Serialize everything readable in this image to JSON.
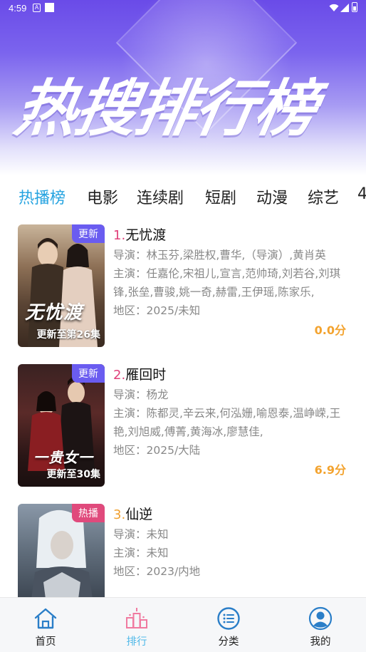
{
  "status_bar": {
    "time": "4:59",
    "a_glyph": "A"
  },
  "header": {
    "title": "热搜排行榜"
  },
  "tabs": [
    {
      "label": "热播榜",
      "active": true
    },
    {
      "label": "电影",
      "active": false
    },
    {
      "label": "连续剧",
      "active": false
    },
    {
      "label": "短剧",
      "active": false
    },
    {
      "label": "动漫",
      "active": false
    },
    {
      "label": "综艺",
      "active": false
    },
    {
      "label": "4",
      "active": false
    }
  ],
  "list": [
    {
      "rank": "1.",
      "rank_color": "#e0407a",
      "title": "无忧渡",
      "badge": "更新",
      "badge_color": "#6a5cf0",
      "poster_caption": "更新至第26集",
      "poster_calligraphy": "无忧渡",
      "director": "导演：林玉芬,梁胜权,曹华,（导演）,黄肖英",
      "cast": "主演：任嘉伦,宋祖儿,宣言,范帅琦,刘若谷,刘琪锋,张垒,曹骏,姚一奇,赫雷,王伊瑶,陈家乐,",
      "region": "地区：2025/未知",
      "score": "0.0分"
    },
    {
      "rank": "2.",
      "rank_color": "#e0407a",
      "title": "雁回时",
      "badge": "更新",
      "badge_color": "#6a5cf0",
      "poster_caption": "更新至30集",
      "poster_calligraphy": "一贵女一",
      "director": "导演：杨龙",
      "cast": "主演：陈都灵,辛云来,何泓姗,喻恩泰,温峥嵘,王艳,刘旭威,傅菁,黄海冰,廖慧佳,",
      "region": "地区：2025/大陆",
      "score": "6.9分"
    },
    {
      "rank": "3.",
      "rank_color": "#f0a030",
      "title": "仙逆",
      "badge": "热播",
      "badge_color": "#e04a7c",
      "poster_caption": "",
      "poster_calligraphy": "",
      "director": "导演：未知",
      "cast": "主演：未知",
      "region": "地区：2023/内地",
      "score": ""
    }
  ],
  "bottom_nav": [
    {
      "label": "首页",
      "icon": "home-icon",
      "active": false
    },
    {
      "label": "排行",
      "icon": "ranking-icon",
      "active": true
    },
    {
      "label": "分类",
      "icon": "category-icon",
      "active": false
    },
    {
      "label": "我的",
      "icon": "profile-icon",
      "active": false
    }
  ],
  "colors": {
    "accent_tab": "#25a3e0",
    "score": "#f3a32f",
    "nav_active": "#4fb8e8",
    "nav_inactive": "#2a7ec8"
  }
}
